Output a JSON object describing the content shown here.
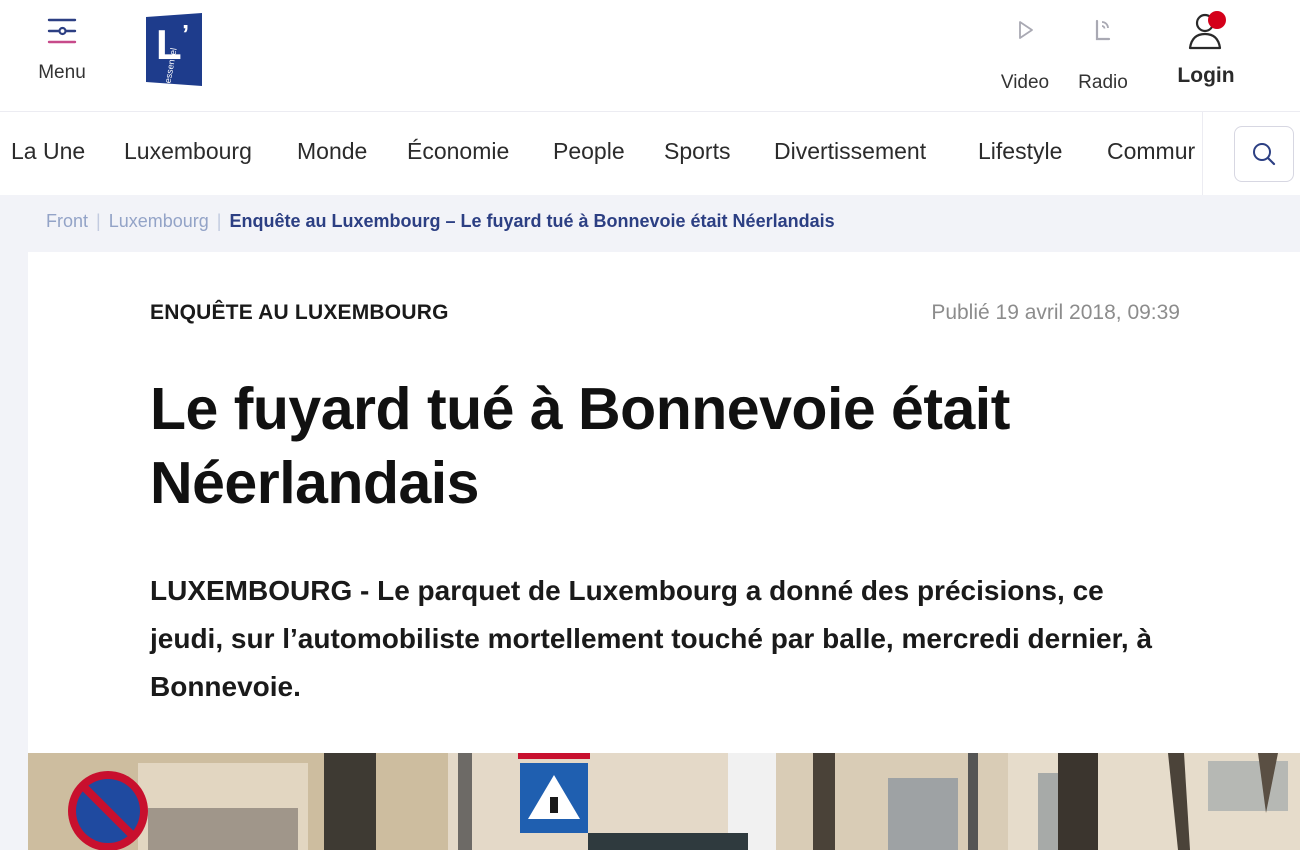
{
  "header": {
    "menu_label": "Menu",
    "video_label": "Video",
    "radio_label": "Radio",
    "login_label": "Login"
  },
  "logo": {
    "big_letter": "L’",
    "small_text": "essentiel",
    "color": "#1e3c8c"
  },
  "nav": {
    "items": [
      "La Une",
      "Luxembourg",
      "Monde",
      "Économie",
      "People",
      "Sports",
      "Divertissement",
      "Lifestyle",
      "Commur"
    ]
  },
  "breadcrumb": {
    "front": "Front",
    "section": "Luxembourg",
    "current": "Enquête au Luxembourg – Le fuyard tué à Bonnevoie était Néerlandais"
  },
  "article": {
    "kicker": "ENQUÊTE AU LUXEMBOURG",
    "published": "Publié 19 avril 2018, 09:39",
    "title": "Le fuyard tué à Bonnevoie était Néerlandais",
    "lead": "LUXEMBOURG - Le parquet de Luxembourg a donné des précisions, ce jeudi, sur l’automobiliste mortellement touché par balle, mercredi dernier, à Bonnevoie."
  },
  "colors": {
    "brand_blue": "#1e3c8c",
    "breadcrumb_current": "#2c3f83",
    "notification_red": "#d4001a",
    "page_background": "#f2f3f8"
  },
  "icons": [
    "menu-icon",
    "play-icon",
    "radio-icon",
    "user-icon",
    "search-icon"
  ]
}
